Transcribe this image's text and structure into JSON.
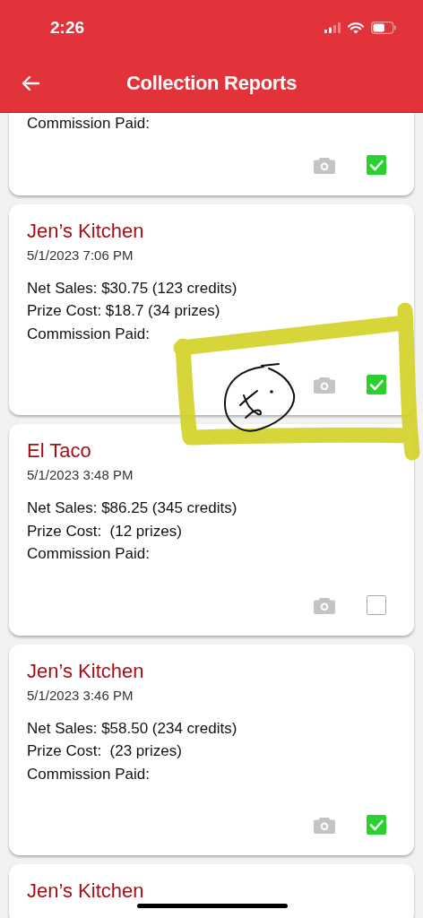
{
  "status_bar": {
    "time": "2:26"
  },
  "header": {
    "title": "Collection Reports"
  },
  "cards": [
    {
      "lines": [
        "Commission Paid:"
      ],
      "checked": true
    },
    {
      "name": "Jen’s Kitchen",
      "datetime": "5/1/2023 7:06 PM",
      "lines": [
        "Net Sales: $30.75 (123 credits)",
        "Prize Cost: $18.7 (34 prizes)",
        "Commission Paid:"
      ],
      "checked": true
    },
    {
      "name": "El Taco",
      "datetime": "5/1/2023 3:48 PM",
      "lines": [
        "Net Sales: $86.25 (345 credits)",
        "Prize Cost:  (12 prizes)",
        "Commission Paid:"
      ],
      "checked": false
    },
    {
      "name": "Jen’s Kitchen",
      "datetime": "5/1/2023 3:46 PM",
      "lines": [
        "Net Sales: $58.50 (234 credits)",
        "Prize Cost:  (23 prizes)",
        "Commission Paid:"
      ],
      "checked": true
    },
    {
      "name": "Jen’s Kitchen"
    }
  ]
}
